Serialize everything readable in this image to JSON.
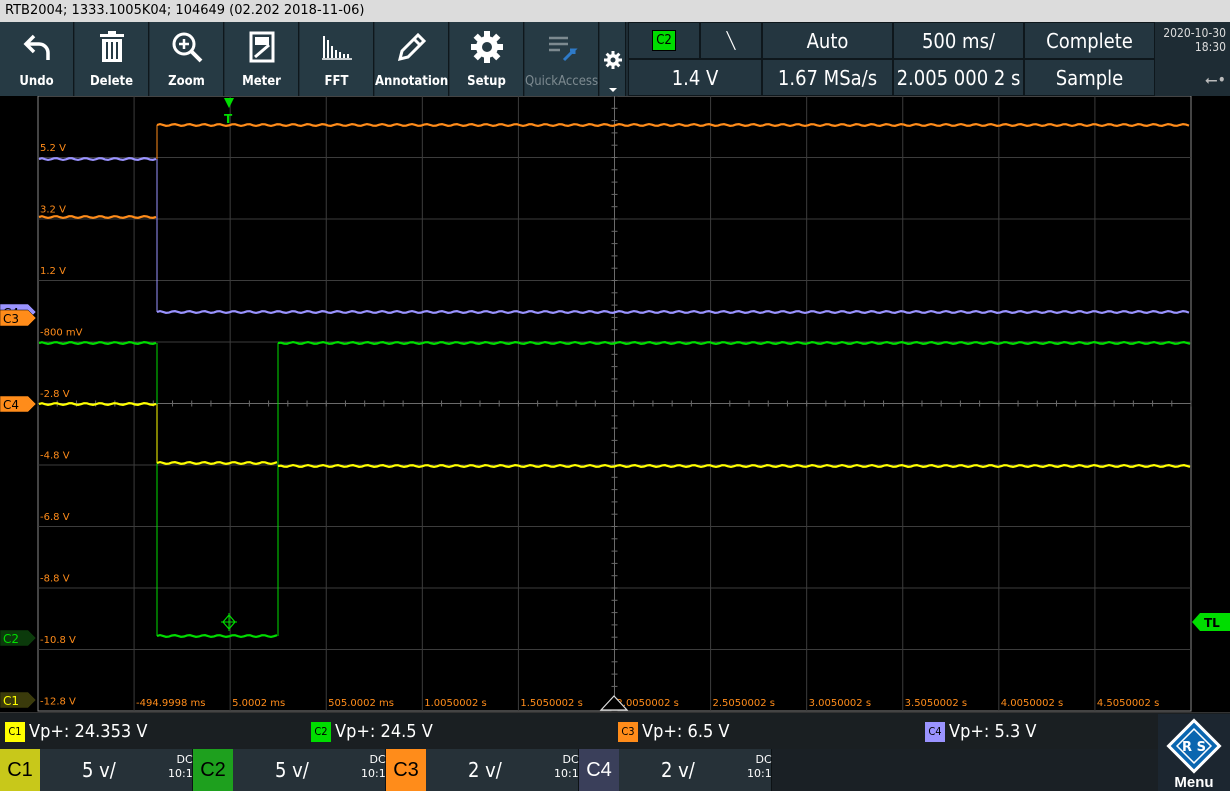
{
  "title_bar": "RTB2004; 1333.1005K04; 104649 (02.202 2018-11-06)",
  "toolbar": [
    {
      "label": "Undo",
      "icon": "undo-icon"
    },
    {
      "label": "Delete",
      "icon": "trash-icon"
    },
    {
      "label": "Zoom",
      "icon": "zoom-icon"
    },
    {
      "label": "Meter",
      "icon": "meter-icon"
    },
    {
      "label": "FFT",
      "icon": "fft-icon"
    },
    {
      "label": "Annotation",
      "icon": "pencil-icon"
    },
    {
      "label": "Setup",
      "icon": "gear-icon"
    },
    {
      "label": "QuickAccess",
      "icon": "quickaccess-icon"
    }
  ],
  "trigger": {
    "source": "C2",
    "slope_symbol": "╲",
    "mode": "Auto",
    "timebase": "500 ms/",
    "status": "Complete",
    "level": "1.4 V",
    "sample_rate": "1.67 MSa/s",
    "position": "2.005 000 2 s",
    "acq_mode": "Sample"
  },
  "datetime": {
    "date": "2020-10-30",
    "time": "18:30"
  },
  "y_labels": [
    "5.2 V",
    "3.2 V",
    "1.2 V",
    "-800 mV",
    "-2.8 V",
    "-4.8 V",
    "-6.8 V",
    "-8.8 V",
    "-10.8 V",
    "-12.8 V"
  ],
  "x_labels": [
    "-494.9998 ms",
    "5.0002 ms",
    "505.0002 ms",
    "1.0050002 s",
    "1.5050002 s",
    "2.0050002 s",
    "2.5050002 s",
    "3.0050002 s",
    "3.5050002 s",
    "4.0050002 s",
    "4.5050002 s"
  ],
  "markers": {
    "trigger_T": "T",
    "trigger_level": "TL",
    "c1": "C1",
    "c2": "C2",
    "c3": "C3",
    "c4": "C4"
  },
  "colors": {
    "c1": "#ffff00",
    "c2": "#00dd00",
    "c3": "#ff8c1a",
    "c4": "#9a93ff",
    "grid": "#3c3c3c",
    "axis_label": "#ff8c1a"
  },
  "measurements": [
    {
      "ch": "C1",
      "text": "Vp+: 24.353 V"
    },
    {
      "ch": "C2",
      "text": "Vp+: 24.5 V"
    },
    {
      "ch": "C3",
      "text": "Vp+: 6.5 V"
    },
    {
      "ch": "C4",
      "text": "Vp+: 5.3 V"
    }
  ],
  "channels": [
    {
      "name": "C1",
      "scale": "5 v/",
      "coupling": "DC",
      "probe": "10:1"
    },
    {
      "name": "C2",
      "scale": "5 v/",
      "coupling": "DC",
      "probe": "10:1"
    },
    {
      "name": "C3",
      "scale": "2 v/",
      "coupling": "DC",
      "probe": "10:1"
    },
    {
      "name": "C4",
      "scale": "2 v/",
      "coupling": "DC",
      "probe": "10:1"
    }
  ],
  "menu_label": "Menu"
}
